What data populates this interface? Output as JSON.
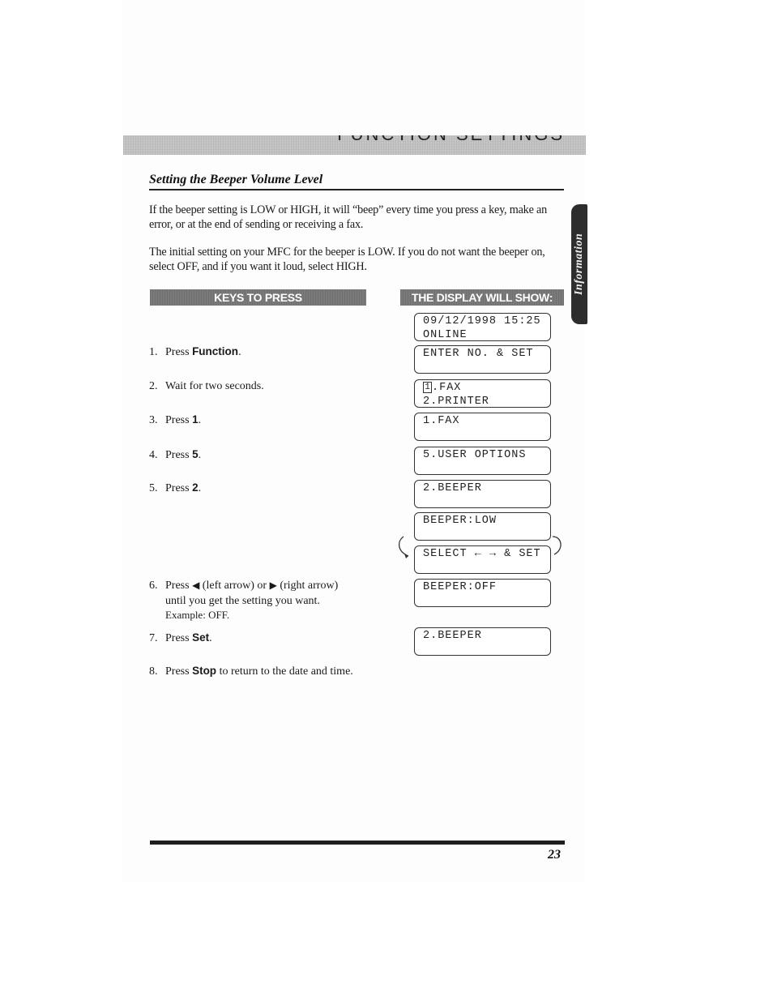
{
  "header": {
    "band_text": "FUNCTION SETTINGS"
  },
  "section": {
    "title": "Setting the Beeper Volume Level",
    "paragraphs": [
      "If the beeper setting is LOW or HIGH, it will “beep” every time you press a key, make an error, or at the end of sending or receiving a fax.",
      "The initial setting on your MFC for the beeper is LOW. If you do not want the beeper on, select OFF, and if you want it loud, select HIGH."
    ]
  },
  "side_tab": {
    "label": "Information"
  },
  "columns": {
    "keys_header": "KEYS TO PRESS",
    "display_header": "THE DISPLAY WILL SHOW:"
  },
  "steps": [
    {
      "num": "1.",
      "pre": "Press ",
      "key": "Function",
      "post": "."
    },
    {
      "num": "2.",
      "pre": "Wait for two seconds.",
      "key": "",
      "post": ""
    },
    {
      "num": "3.",
      "pre": "Press ",
      "key": "1",
      "post": "."
    },
    {
      "num": "4.",
      "pre": "Press ",
      "key": "5",
      "post": "."
    },
    {
      "num": "5.",
      "pre": "Press ",
      "key": "2",
      "post": "."
    },
    {
      "num": "6.",
      "pre": "Press ",
      "left_arrow": "◀",
      "mid": " (left arrow) or ",
      "right_arrow": "▶",
      "post": " (right arrow)",
      "line2": "until you get the setting you want.",
      "example": "Example: OFF."
    },
    {
      "num": "7.",
      "pre": "Press ",
      "key": "Set",
      "post": "."
    },
    {
      "num": "8.",
      "pre": "Press ",
      "key": "Stop",
      "post": " to return to the date and time."
    }
  ],
  "displays": [
    {
      "line1": "09/12/1998 15:25",
      "line2": "ONLINE"
    },
    {
      "line1": "ENTER NO. & SET",
      "line2": ""
    },
    {
      "cursor": "1",
      "line1": ".FAX",
      "line2": "2.PRINTER"
    },
    {
      "line1": "1.FAX",
      "line2": ""
    },
    {
      "line1": "5.USER OPTIONS",
      "line2": ""
    },
    {
      "line1": "2.BEEPER",
      "line2": ""
    },
    {
      "line1": "BEEPER:LOW",
      "line2": ""
    },
    {
      "line1": "SELECT ← → & SET",
      "line2": ""
    },
    {
      "line1": "BEEPER:OFF",
      "line2": ""
    },
    {
      "line1": "2.BEEPER",
      "line2": ""
    }
  ],
  "footer": {
    "page_number": "23"
  }
}
